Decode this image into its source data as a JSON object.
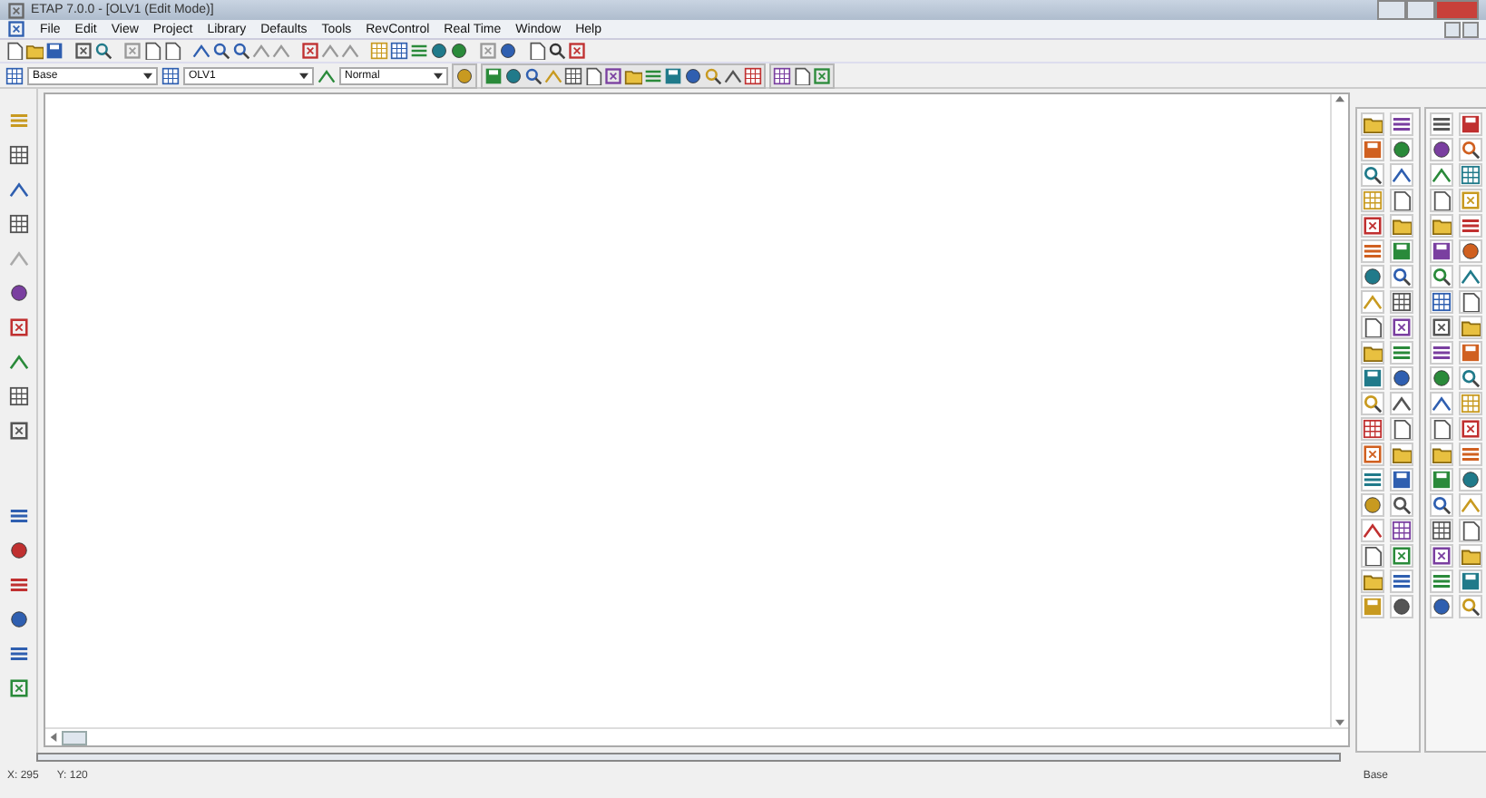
{
  "window": {
    "title": "ETAP 7.0.0 - [OLV1 (Edit Mode)]"
  },
  "menu": [
    "File",
    "Edit",
    "View",
    "Project",
    "Library",
    "Defaults",
    "Tools",
    "RevControl",
    "Real Time",
    "Window",
    "Help"
  ],
  "dropdowns": [
    {
      "value": "Base"
    },
    {
      "value": "OLV1"
    },
    {
      "value": "Normal"
    }
  ],
  "status_bar": {
    "x": "X: 295",
    "y": "Y: 120",
    "revision": "Base"
  }
}
